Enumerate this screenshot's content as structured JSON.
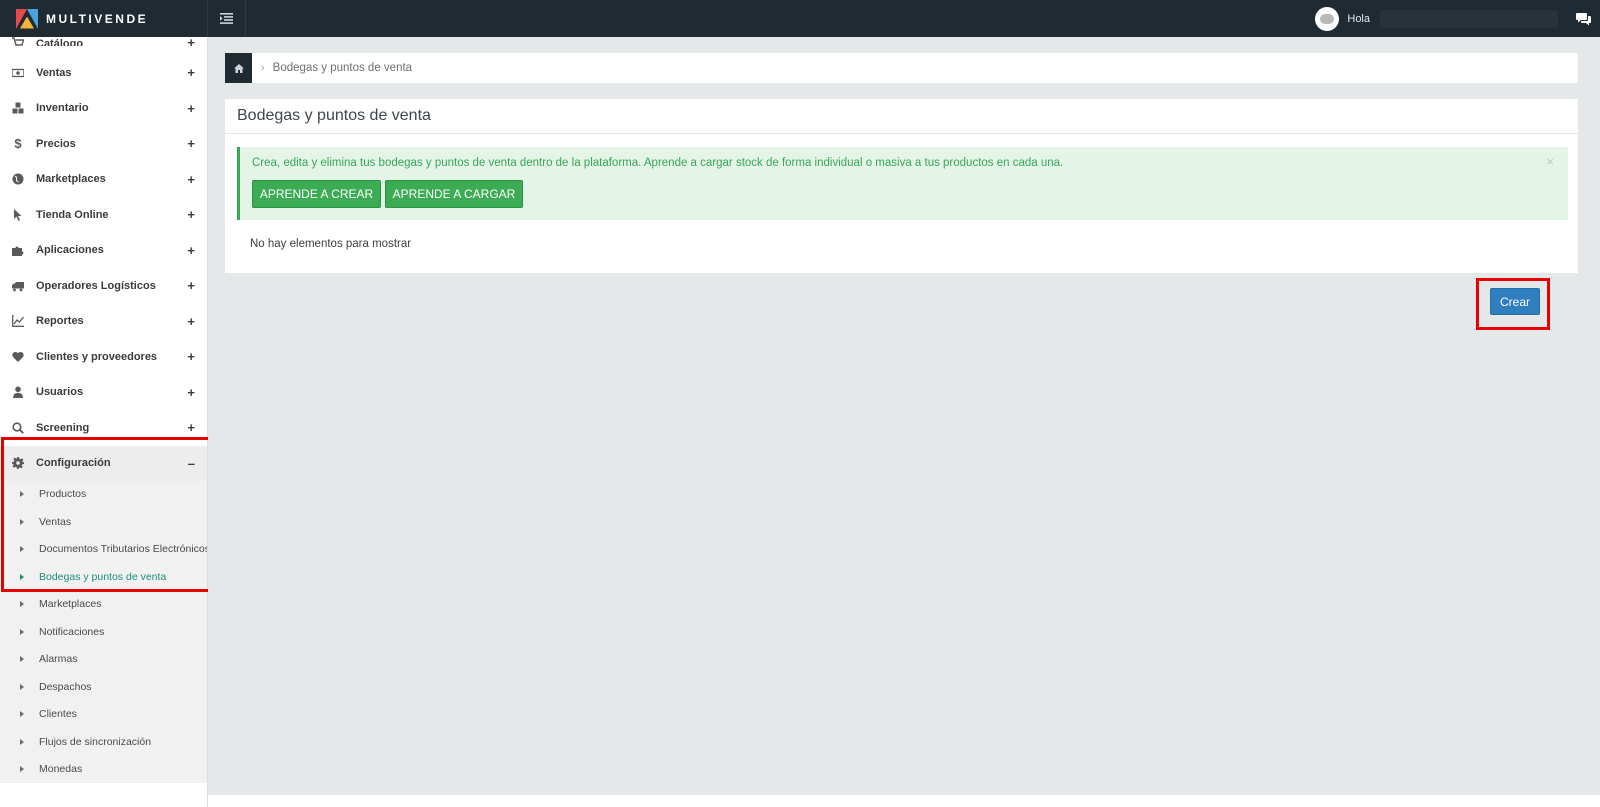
{
  "brand": {
    "name": "MULTIVENDE"
  },
  "header": {
    "greeting": "Hola"
  },
  "sidebar": {
    "items": [
      {
        "label": "Catálogo",
        "toggle": "+",
        "icon": "cart-icon"
      },
      {
        "label": "Ventas",
        "toggle": "+",
        "icon": "money-icon"
      },
      {
        "label": "Inventario",
        "toggle": "+",
        "icon": "cubes-icon"
      },
      {
        "label": "Precios",
        "toggle": "+",
        "icon": "dollar-icon"
      },
      {
        "label": "Marketplaces",
        "toggle": "+",
        "icon": "globe-icon"
      },
      {
        "label": "Tienda Online",
        "toggle": "+",
        "icon": "cursor-icon"
      },
      {
        "label": "Aplicaciones",
        "toggle": "+",
        "icon": "puzzle-icon"
      },
      {
        "label": "Operadores Logísticos",
        "toggle": "+",
        "icon": "truck-icon"
      },
      {
        "label": "Reportes",
        "toggle": "+",
        "icon": "line-chart-icon"
      },
      {
        "label": "Clientes y proveedores",
        "toggle": "+",
        "icon": "heart-icon"
      },
      {
        "label": "Usuarios",
        "toggle": "+",
        "icon": "user-icon"
      },
      {
        "label": "Screening",
        "toggle": "+",
        "icon": "search-icon"
      },
      {
        "label": "Configuración",
        "toggle": "–",
        "icon": "gear-icon"
      }
    ],
    "config_submenu": [
      "Productos",
      "Ventas",
      "Documentos Tributarios Electrónicos",
      "Bodegas y puntos de venta",
      "Marketplaces",
      "Notificaciones",
      "Alarmas",
      "Despachos",
      "Clientes",
      "Flujos de sincronización",
      "Monedas"
    ],
    "current_submenu_index": 3
  },
  "breadcrumb": {
    "current": "Bodegas y puntos de venta",
    "separator": "›"
  },
  "panel": {
    "title": "Bodegas y puntos de venta",
    "alert": {
      "text": "Crea, edita y elimina tus bodegas y puntos de venta dentro de la plataforma. Aprende a cargar stock de forma individual o masiva a tus productos en cada una.",
      "close": "×",
      "button_create": "APRENDE A CREAR",
      "button_load": "APRENDE A CARGAR"
    },
    "empty_message": "No hay elementos para mostrar"
  },
  "actions": {
    "create_label": "Crear"
  },
  "colors": {
    "topbar": "#1f2a33",
    "success_green": "#3cac54",
    "alert_bg": "#e4f4e6",
    "primary_blue": "#2f7ebd",
    "active_link": "#1b8f7a",
    "highlight_red": "#e60000"
  }
}
